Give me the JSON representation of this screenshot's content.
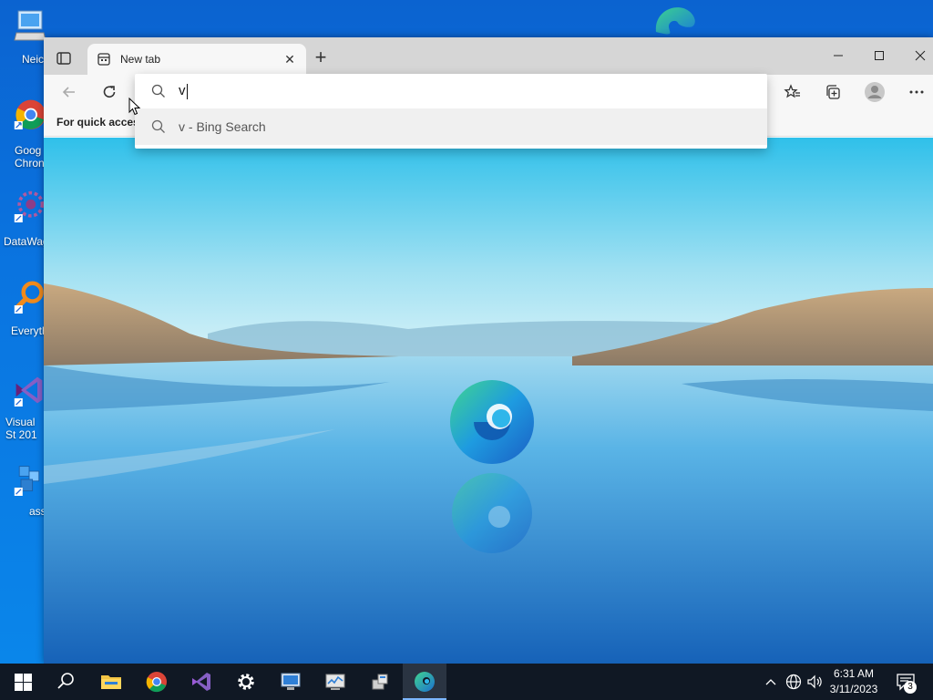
{
  "desktop": {
    "icons": [
      {
        "label": "Neic",
        "icon": "computer-icon"
      },
      {
        "label": "Goog Chron",
        "icon": "chrome-icon"
      },
      {
        "label": "DataWag",
        "icon": "datawag-icon"
      },
      {
        "label": "Everyth",
        "icon": "everything-search-icon"
      },
      {
        "label": "Visual St 201",
        "icon": "visual-studio-icon"
      },
      {
        "label": "ass",
        "icon": "package-icon"
      }
    ]
  },
  "browser": {
    "tab": {
      "title": "New tab",
      "close": "✕"
    },
    "new_tab": "+",
    "favorites_bar": {
      "text": "For quick access"
    },
    "omnibox": {
      "typed": "v",
      "suggestions": [
        {
          "text": "v - Bing Search"
        }
      ]
    }
  },
  "taskbar": {
    "clock": {
      "time": "6:31 AM",
      "date": "3/11/2023"
    },
    "notifications_count": "3"
  },
  "colors": {
    "desktop": "#0a74e0",
    "titlebar": "#d6d6d6",
    "toolbar": "#f7f7f7",
    "taskbar": "#101824",
    "accent": "#0b5fc6"
  }
}
